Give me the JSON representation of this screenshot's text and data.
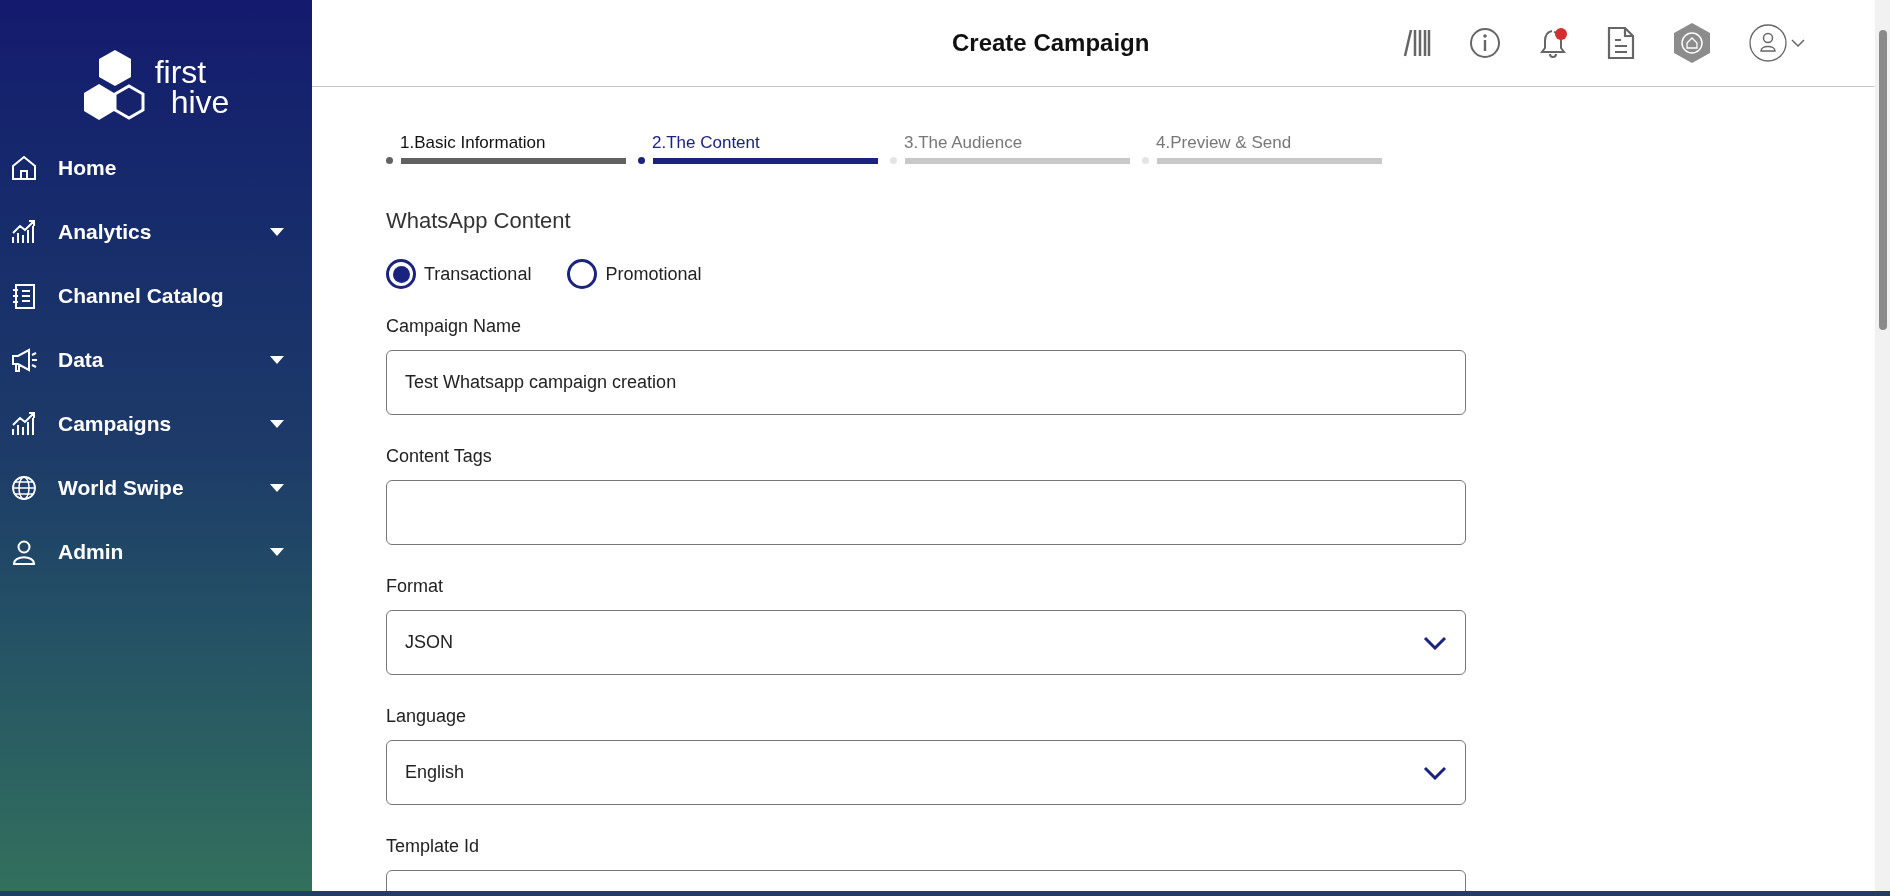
{
  "sidebar": {
    "logo": {
      "line_1": "first",
      "line_2": "hive"
    },
    "items": [
      {
        "label": "Home",
        "has_dropdown": false
      },
      {
        "label": "Analytics",
        "has_dropdown": true
      },
      {
        "label": "Channel Catalog",
        "has_dropdown": false
      },
      {
        "label": "Data",
        "has_dropdown": true
      },
      {
        "label": "Campaigns",
        "has_dropdown": true
      },
      {
        "label": "World Swipe",
        "has_dropdown": true
      },
      {
        "label": "Admin",
        "has_dropdown": true
      }
    ]
  },
  "header": {
    "title": "Create Campaign",
    "notification": true
  },
  "steps": [
    {
      "label": "1.Basic Information",
      "completed": true,
      "selected": false
    },
    {
      "label": "2.The Content",
      "completed": false,
      "selected": true
    },
    {
      "label": "3.The Audience",
      "completed": false,
      "selected": false
    },
    {
      "label": "4.Preview & Send",
      "completed": false,
      "selected": false
    }
  ],
  "section_title": "WhatsApp Content",
  "message_type": [
    {
      "label": "Transactional",
      "selected": true
    },
    {
      "label": "Promotional",
      "selected": false
    }
  ],
  "fields": [
    {
      "label": "Campaign Name",
      "kind": "text",
      "value": "Test Whatsapp campaign creation"
    },
    {
      "label": "Content Tags",
      "kind": "text"
    },
    {
      "label": "Format",
      "kind": "select",
      "value": "JSON"
    },
    {
      "label": "Language",
      "kind": "select",
      "value": "English"
    },
    {
      "label": "Template Id",
      "kind": "text"
    }
  ]
}
